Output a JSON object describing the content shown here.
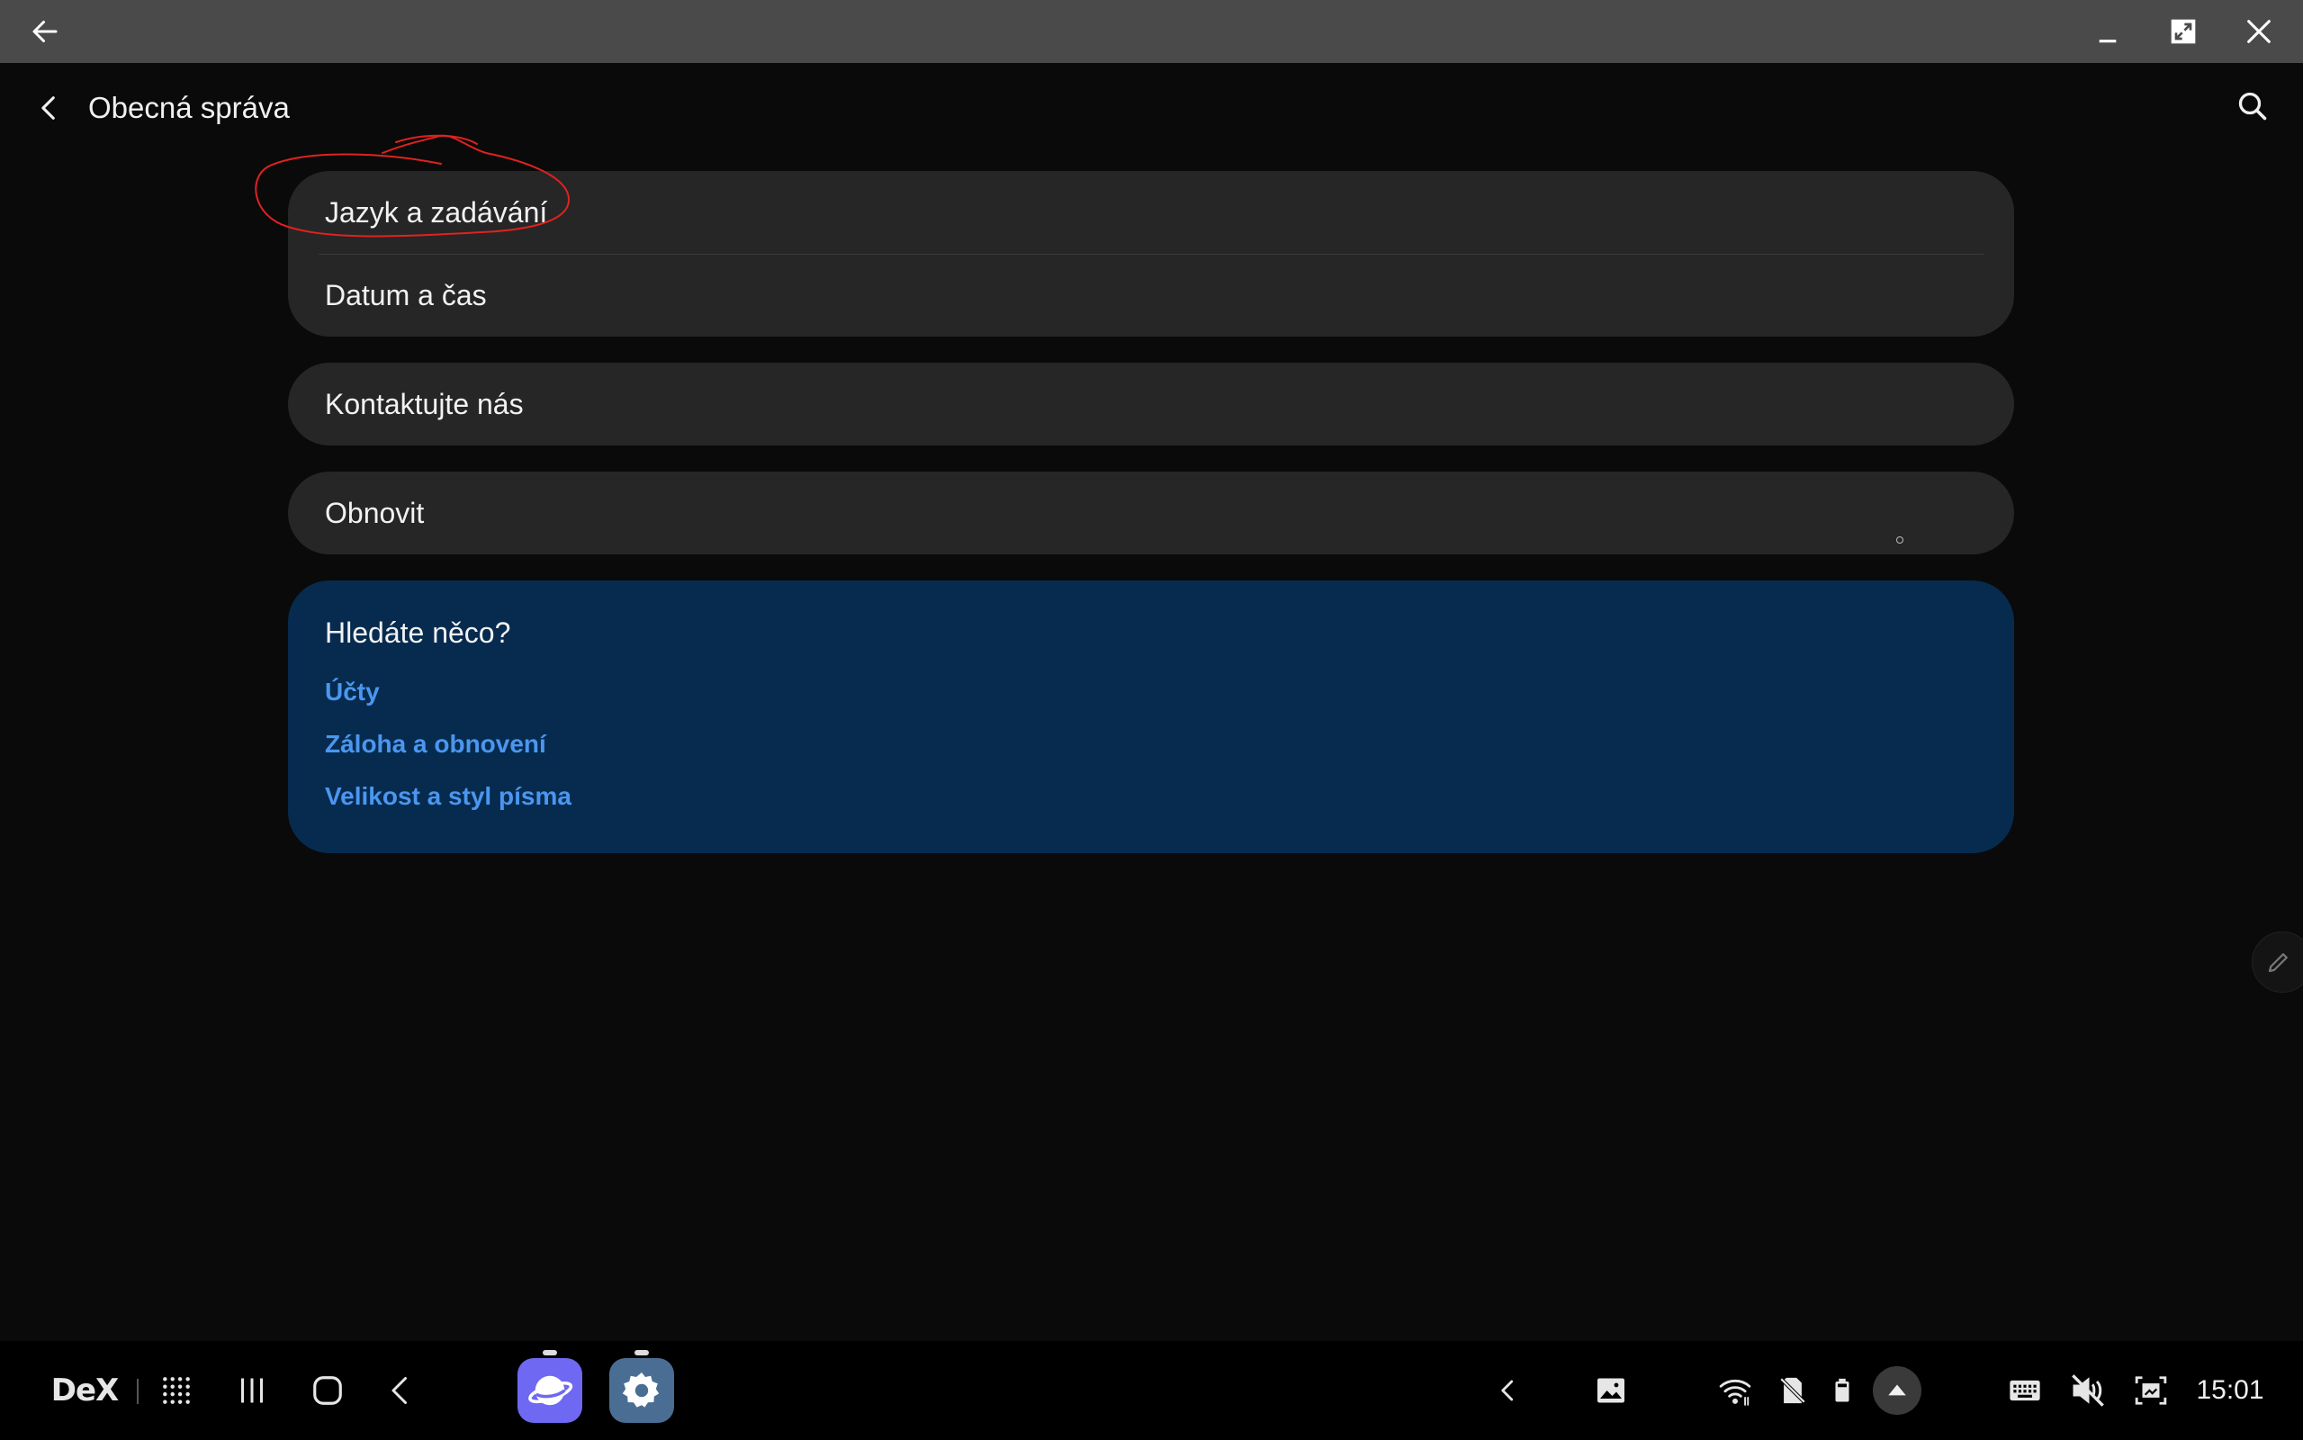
{
  "header": {
    "title": "Obecná správa"
  },
  "settings_group_1": [
    {
      "label": "Jazyk a zadávání"
    },
    {
      "label": "Datum a čas"
    }
  ],
  "settings_group_2": [
    {
      "label": "Kontaktujte nás"
    }
  ],
  "settings_group_3": [
    {
      "label": "Obnovit"
    }
  ],
  "suggestions": {
    "title": "Hledáte něco?",
    "links": [
      "Účty",
      "Záloha a obnovení",
      "Velikost a styl písma"
    ]
  },
  "taskbar": {
    "dex_label": "DeX",
    "time": "15:01",
    "pinned_apps": [
      "samsung-internet-icon",
      "settings-icon"
    ]
  },
  "colors": {
    "background": "#0a0a0a",
    "card": "#262626",
    "suggestion_card": "#062b4f",
    "link": "#4b96ef",
    "annotation": "#e0221f",
    "titlebar": "#4a4a4a"
  }
}
